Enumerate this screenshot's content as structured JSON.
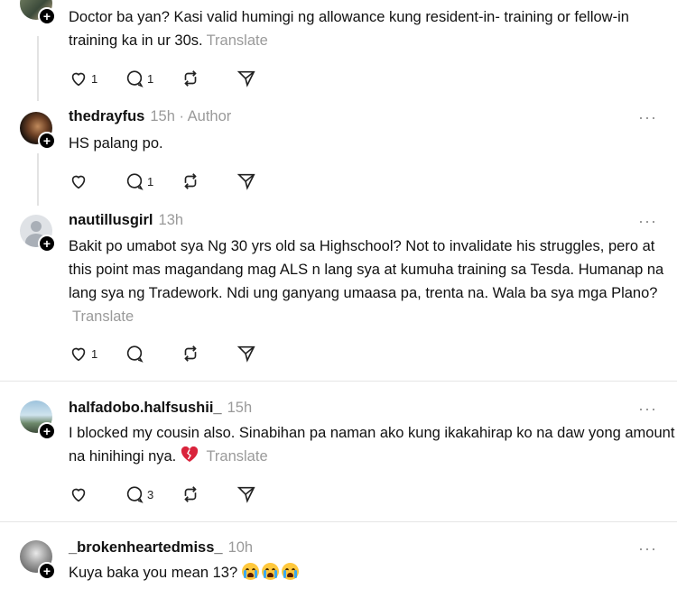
{
  "actions": {
    "like_label": "Like",
    "reply_label": "Reply",
    "repost_label": "Repost",
    "share_label": "Share",
    "more_label": "···"
  },
  "posts": [
    {
      "text": "Doctor ba yan? Kasi valid humingi ng allowance kung resident-in- training or fellow-in training ka in ur 30s.",
      "translate": "Translate",
      "likes": "1",
      "replies": "1"
    },
    {
      "username": "thedrayfus",
      "time": "15h",
      "author": "· Author",
      "text": "HS palang po.",
      "likes": "",
      "replies": "1"
    },
    {
      "username": "nautillusgirl",
      "time": "13h",
      "text": "Bakit po umabot sya Ng 30 yrs old sa Highschool? Not to invalidate his struggles, pero at this point mas magandang mag ALS n lang sya at kumuha training sa Tesda. Humanap na lang sya ng Tradework. Ndi ung ganyang umaasa pa, trenta na. Wala ba sya mga Plano?",
      "translate": "Translate",
      "likes": "1",
      "replies": ""
    },
    {
      "username": "halfadobo.halfsushii_",
      "time": "15h",
      "text": "I blocked my cousin also. Sinabihan pa naman ako kung ikakahirap ko na daw yong amount na hinihingi nya.",
      "translate": "Translate",
      "likes": "",
      "replies": "3"
    },
    {
      "username": "_brokenheartedmiss_",
      "time": "10h",
      "text": "Kuya baka you mean 13?"
    }
  ],
  "icons": {
    "heart": "heart-icon",
    "reply": "comment-icon",
    "repost": "repost-icon",
    "share": "send-icon",
    "broken_heart": "broken-heart-emoji",
    "crying": "loudly-crying-face-emoji",
    "follow": "plus-icon"
  },
  "colors": {
    "muted": "#9a9a9a",
    "text": "#111111",
    "divider": "#e5e5e5",
    "thread_line": "#e3e3e3"
  }
}
